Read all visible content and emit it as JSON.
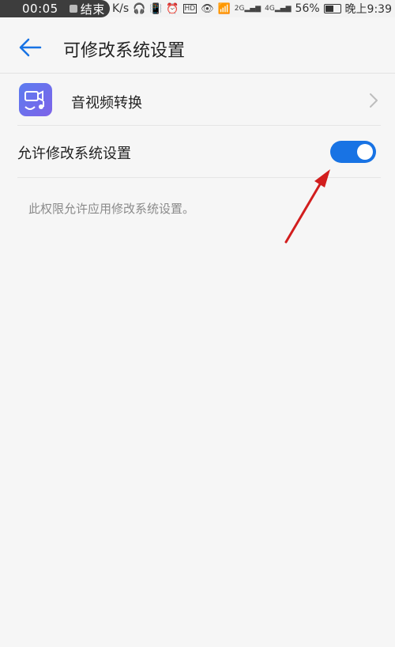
{
  "status_bar": {
    "recording_time": "00:05",
    "stop_label": "结束",
    "speed_unit": "K/s",
    "signal_2g": "2G",
    "signal_4g": "4G",
    "battery": "56%",
    "clock": "晚上9:39"
  },
  "header": {
    "title": "可修改系统设置"
  },
  "app": {
    "name": "音视频转换",
    "icon": "video-convert-icon"
  },
  "setting": {
    "label": "允许修改系统设置",
    "enabled": true,
    "description": "此权限允许应用修改系统设置。"
  },
  "colors": {
    "accent": "#1873e4",
    "annotation_arrow": "#d21e1e"
  }
}
